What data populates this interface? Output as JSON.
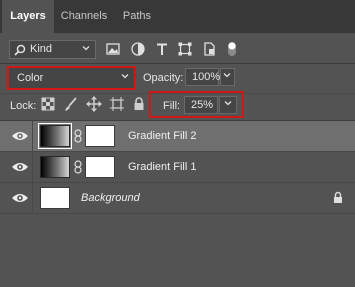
{
  "tabs": [
    {
      "label": "Layers",
      "active": true
    },
    {
      "label": "Channels",
      "active": false
    },
    {
      "label": "Paths",
      "active": false
    }
  ],
  "filter": {
    "kind_label": "Kind",
    "filter_icons": [
      "image-filter-icon",
      "adjustment-filter-icon",
      "type-filter-icon",
      "shape-filter-icon",
      "smart-object-filter-icon",
      "filter-toggle-icon"
    ]
  },
  "blend_mode": {
    "value": "Color",
    "highlighted": true
  },
  "opacity": {
    "label": "Opacity:",
    "value": "100%"
  },
  "lock": {
    "label": "Lock:",
    "icons": [
      "lock-transparent-pixels-icon",
      "lock-image-pixels-icon",
      "lock-position-icon",
      "lock-artboard-icon",
      "lock-all-icon"
    ]
  },
  "fill": {
    "label": "Fill:",
    "value": "25%",
    "highlighted": true
  },
  "layers": [
    {
      "name": "Gradient Fill 2",
      "selected": true,
      "visible": true,
      "type": "gradient-fill"
    },
    {
      "name": "Gradient Fill 1",
      "selected": false,
      "visible": true,
      "type": "gradient-fill"
    },
    {
      "name": "Background",
      "selected": false,
      "visible": true,
      "type": "background",
      "locked": true
    }
  ],
  "colors": {
    "panel_bg": "#535353",
    "tab_bar_bg": "#383838",
    "selected_layer_bg": "#6f6f6f",
    "highlight_border": "#d01818"
  }
}
